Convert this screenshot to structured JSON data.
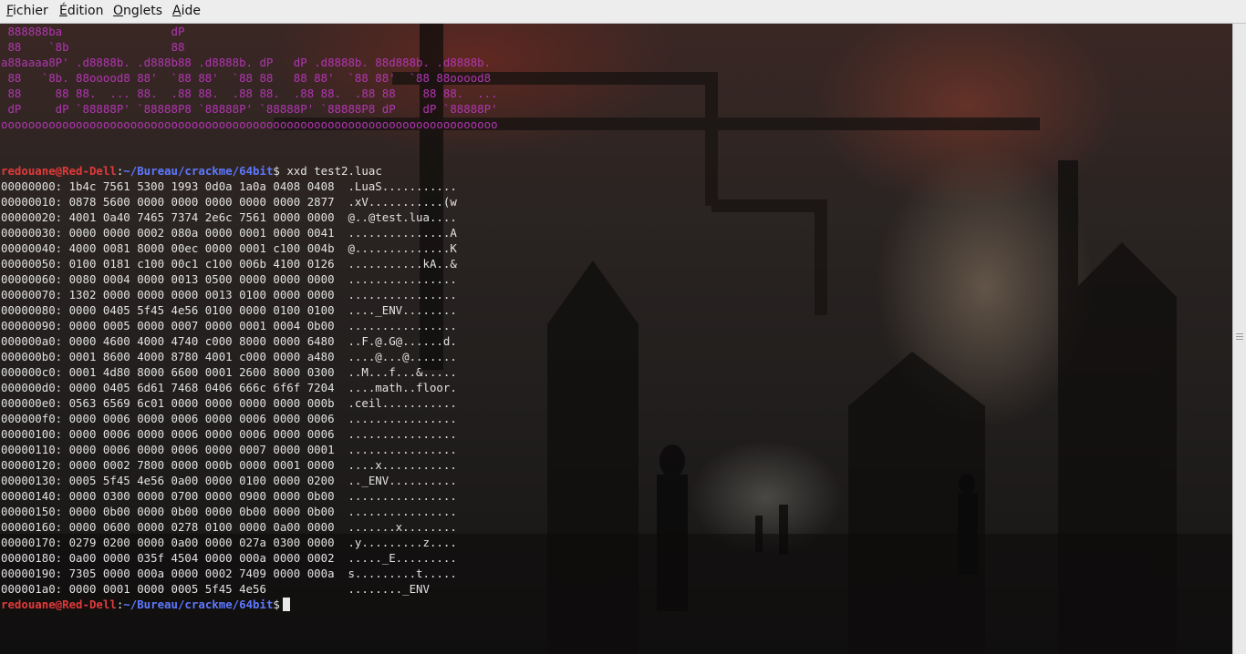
{
  "menu": {
    "file": "Fichier",
    "edit": "Édition",
    "tabs": "Onglets",
    "help": "Aide"
  },
  "banner": [
    " 888888ba                dP",
    " 88    `8b               88",
    "a88aaaa8P' .d8888b. .d888b88 .d8888b. dP   dP .d8888b. 88d888b. .d8888b.",
    " 88   `8b. 88ooood8 88'  `88 88'  `88 88   88 88'  `88 88'  `88 88ooood8",
    " 88     88 88.  ... 88.  .88 88.  .88 88.  .88 88.  .88 88    88 88.  ...",
    " dP     dP `88888P' `88888P8 `88888P' `88888P' `88888P8 dP    dP `88888P'",
    "ooooooooooooooooooooooooooooooooooooooooooooooooooooooooooooooooooooooooo"
  ],
  "prompt": {
    "user_host": "redouane@Red-Dell",
    "sep": ":",
    "path": "~/Bureau/crackme/64bit",
    "symbol": "$",
    "command": " xxd test2.luac"
  },
  "hexdump": [
    "00000000: 1b4c 7561 5300 1993 0d0a 1a0a 0408 0408  .LuaS...........",
    "00000010: 0878 5600 0000 0000 0000 0000 0000 2877  .xV...........(w",
    "00000020: 4001 0a40 7465 7374 2e6c 7561 0000 0000  @..@test.lua....",
    "00000030: 0000 0000 0002 080a 0000 0001 0000 0041  ...............A",
    "00000040: 4000 0081 8000 00ec 0000 0001 c100 004b  @..............K",
    "00000050: 0100 0181 c100 00c1 c100 006b 4100 0126  ...........kA..&",
    "00000060: 0080 0004 0000 0013 0500 0000 0000 0000  ................",
    "00000070: 1302 0000 0000 0000 0013 0100 0000 0000  ................",
    "00000080: 0000 0405 5f45 4e56 0100 0000 0100 0100  ...._ENV........",
    "00000090: 0000 0005 0000 0007 0000 0001 0004 0b00  ................",
    "000000a0: 0000 4600 4000 4740 c000 8000 0000 6480  ..F.@.G@......d.",
    "000000b0: 0001 8600 4000 8780 4001 c000 0000 a480  ....@...@.......",
    "000000c0: 0001 4d80 8000 6600 0001 2600 8000 0300  ..M...f...&.....",
    "000000d0: 0000 0405 6d61 7468 0406 666c 6f6f 7204  ....math..floor.",
    "000000e0: 0563 6569 6c01 0000 0000 0000 0000 000b  .ceil...........",
    "000000f0: 0000 0006 0000 0006 0000 0006 0000 0006  ................",
    "00000100: 0000 0006 0000 0006 0000 0006 0000 0006  ................",
    "00000110: 0000 0006 0000 0006 0000 0007 0000 0001  ................",
    "00000120: 0000 0002 7800 0000 000b 0000 0001 0000  ....x...........",
    "00000130: 0005 5f45 4e56 0a00 0000 0100 0000 0200  .._ENV..........",
    "00000140: 0000 0300 0000 0700 0000 0900 0000 0b00  ................",
    "00000150: 0000 0b00 0000 0b00 0000 0b00 0000 0b00  ................",
    "00000160: 0000 0600 0000 0278 0100 0000 0a00 0000  .......x........",
    "00000170: 0279 0200 0000 0a00 0000 027a 0300 0000  .y.........z....",
    "00000180: 0a00 0000 035f 4504 0000 000a 0000 0002  ....._E.........",
    "00000190: 7305 0000 000a 0000 0002 7409 0000 000a  s.........t.....",
    "000001a0: 0000 0001 0000 0005 5f45 4e56            ........_ENV"
  ],
  "colors": {
    "banner": "#b236b2",
    "user_host": "#e23a3a",
    "path": "#5e78ff",
    "text": "#e3e3e3"
  },
  "icons": [
    "scrollbar-grip-icon",
    "cursor-block-icon"
  ]
}
